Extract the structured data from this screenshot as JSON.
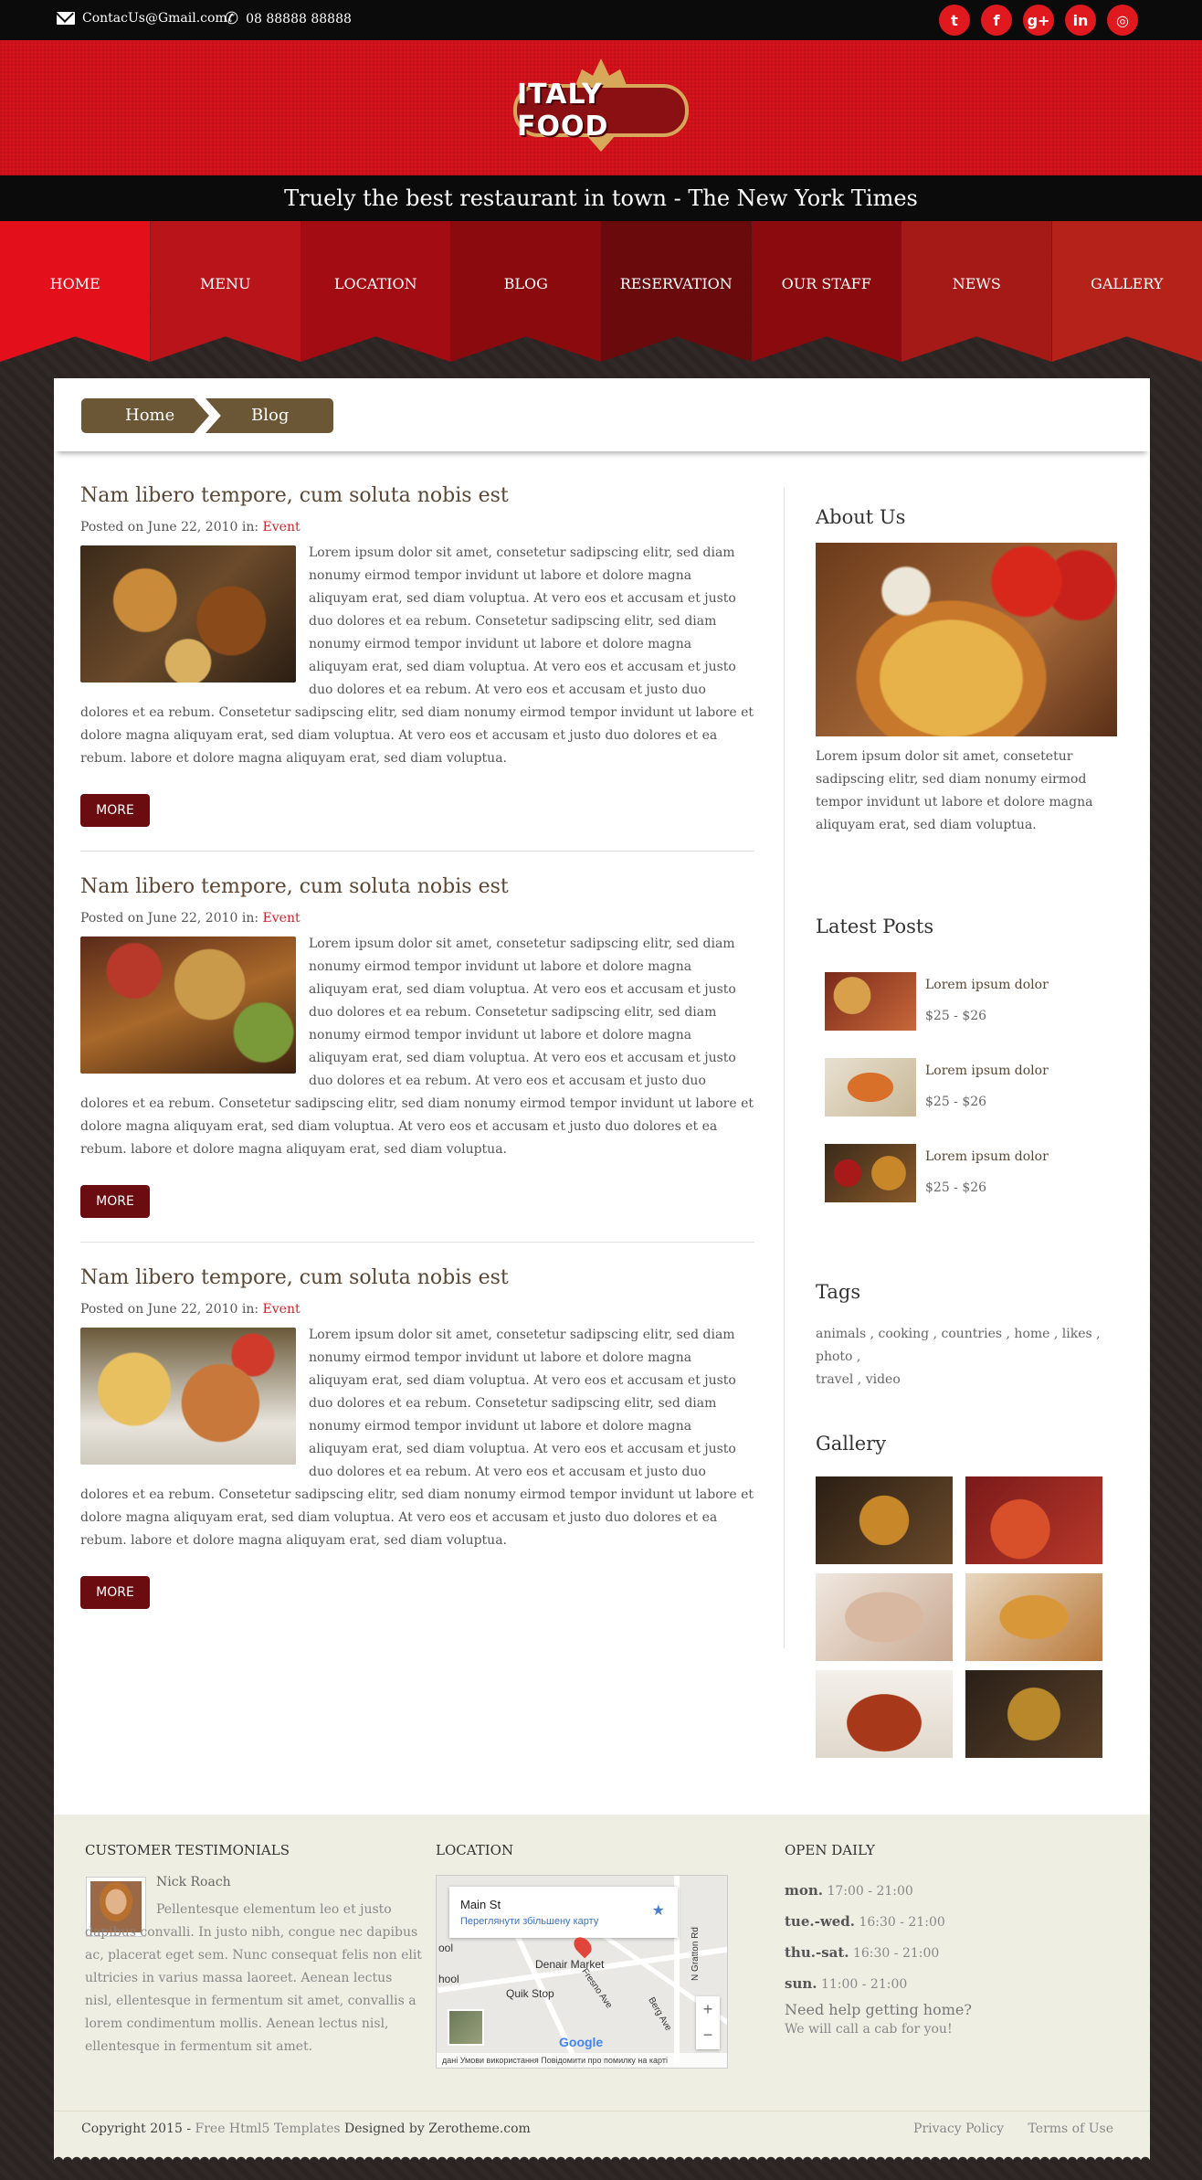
{
  "topbar": {
    "email": "ContacUs@Gmail.com",
    "phone": "08 88888 88888",
    "socials": [
      {
        "icon": "twitter-icon",
        "glyph": "t"
      },
      {
        "icon": "facebook-icon",
        "glyph": "f"
      },
      {
        "icon": "google-plus-icon",
        "glyph": "g+"
      },
      {
        "icon": "linkedin-icon",
        "glyph": "in"
      },
      {
        "icon": "instagram-icon",
        "glyph": "◎"
      }
    ]
  },
  "header": {
    "logo_text": "ITALY FOOD",
    "tagline": "Truely the best restaurant in town - The New York Times"
  },
  "nav": {
    "items": [
      {
        "label": "HOME",
        "color": "#e3101b"
      },
      {
        "label": "MENU",
        "color": "#b9141a"
      },
      {
        "label": "LOCATION",
        "color": "#a30c12"
      },
      {
        "label": "BLOG",
        "color": "#8a0a0e"
      },
      {
        "label": "RESERVATION",
        "color": "#6a0a0c"
      },
      {
        "label": "OUR STAFF",
        "color": "#8a0a0e"
      },
      {
        "label": "NEWS",
        "color": "#a51a17"
      },
      {
        "label": "GALLERY",
        "color": "#b5221a"
      }
    ]
  },
  "breadcrumb": {
    "home": "Home",
    "current": "Blog"
  },
  "posts": [
    {
      "title": "Nam libero tempore, cum soluta nobis est",
      "meta_prefix": "Posted on June 22, 2010 in:",
      "category": "Event",
      "body": "Lorem ipsum dolor sit amet, consetetur sadipscing elitr, sed diam nonumy eirmod tempor invidunt ut labore et dolore magna aliquyam erat, sed diam voluptua. At vero eos et accusam et justo duo dolores et ea rebum. Consetetur sadipscing elitr, sed diam nonumy eirmod tempor invidunt ut labore et dolore magna aliquyam erat, sed diam voluptua. At vero eos et accusam et justo duo dolores et ea rebum. At vero eos et accusam et justo duo dolores et ea rebum. Consetetur sadipscing elitr, sed diam nonumy eirmod tempor invidunt ut labore et dolore magna aliquyam erat, sed diam voluptua. At vero eos et accusam et justo duo dolores et ea rebum. labore et dolore magna aliquyam erat, sed diam voluptua.",
      "more": "MORE"
    },
    {
      "title": "Nam libero tempore, cum soluta nobis est",
      "meta_prefix": "Posted on June 22, 2010 in:",
      "category": "Event",
      "body": "Lorem ipsum dolor sit amet, consetetur sadipscing elitr, sed diam nonumy eirmod tempor invidunt ut labore et dolore magna aliquyam erat, sed diam voluptua. At vero eos et accusam et justo duo dolores et ea rebum. Consetetur sadipscing elitr, sed diam nonumy eirmod tempor invidunt ut labore et dolore magna aliquyam erat, sed diam voluptua. At vero eos et accusam et justo duo dolores et ea rebum. At vero eos et accusam et justo duo dolores et ea rebum. Consetetur sadipscing elitr, sed diam nonumy eirmod tempor invidunt ut labore et dolore magna aliquyam erat, sed diam voluptua. At vero eos et accusam et justo duo dolores et ea rebum. labore et dolore magna aliquyam erat, sed diam voluptua.",
      "more": "MORE"
    },
    {
      "title": "Nam libero tempore, cum soluta nobis est",
      "meta_prefix": "Posted on June 22, 2010 in:",
      "category": "Event",
      "body": "Lorem ipsum dolor sit amet, consetetur sadipscing elitr, sed diam nonumy eirmod tempor invidunt ut labore et dolore magna aliquyam erat, sed diam voluptua. At vero eos et accusam et justo duo dolores et ea rebum. Consetetur sadipscing elitr, sed diam nonumy eirmod tempor invidunt ut labore et dolore magna aliquyam erat, sed diam voluptua. At vero eos et accusam et justo duo dolores et ea rebum. At vero eos et accusam et justo duo dolores et ea rebum. Consetetur sadipscing elitr, sed diam nonumy eirmod tempor invidunt ut labore et dolore magna aliquyam erat, sed diam voluptua. At vero eos et accusam et justo duo dolores et ea rebum. labore et dolore magna aliquyam erat, sed diam voluptua.",
      "more": "MORE"
    }
  ],
  "sidebar": {
    "about_title": "About Us",
    "about_text": "Lorem ipsum dolor sit amet, consetetur sadipscing elitr, sed diam nonumy eirmod tempor invidunt ut labore et dolore magna aliquyam erat, sed diam voluptua.",
    "latest_title": "Latest Posts",
    "latest": [
      {
        "title": "Lorem ipsum dolor",
        "price": "$25 - $26"
      },
      {
        "title": "Lorem ipsum dolor",
        "price": "$25 - $26"
      },
      {
        "title": "Lorem ipsum dolor",
        "price": "$25 - $26"
      }
    ],
    "tags_title": "Tags",
    "tags": [
      "animals",
      "cooking",
      "countries",
      "home",
      "likes",
      "photo",
      "travel",
      "video"
    ],
    "gallery_title": "Gallery"
  },
  "footer": {
    "testimonials_title": "CUSTOMER TESTIMONIALS",
    "testimonial_name": "Nick Roach",
    "testimonial_text": "Pellentesque elementum leo et justo dapibus convalli. In justo nibh, congue nec dapibus ac, placerat eget sem. Nunc consequat felis non elit ultricies in varius massa laoreet. Aenean lectus nisl, ellentesque in fermentum sit amet, convallis a lorem condimentum mollis. Aenean lectus nisl, ellentesque in fermentum sit amet.",
    "location_title": "LOCATION",
    "map": {
      "place": "Main St",
      "view_larger": "Переглянути збільшену карту",
      "label_market": "Denair Market",
      "label_quik": "Quik Stop",
      "label_ool1": "ool",
      "label_ool2": "hool",
      "street1": "N Gratton Rd",
      "street2": "Fresno Ave",
      "street3": "Berg Ave",
      "google": "Google",
      "footer_text": "дані  Умови використання  Повідомити про помилку на карті"
    },
    "open_title": "OPEN DAILY",
    "hours": [
      {
        "day": "mon.",
        "time": "17:00 - 21:00"
      },
      {
        "day": "tue.-wed.",
        "time": "16:30 - 21:00"
      },
      {
        "day": "thu.-sat.",
        "time": "16:30 - 21:00"
      },
      {
        "day": "sun.",
        "time": "11:00 - 21:00"
      }
    ],
    "need_help": "Need help getting home?",
    "cab": "We will call a cab for you!",
    "copyright_prefix": "Copyright 2015 -",
    "free_templates": "Free Html5 Templates",
    "designed_by": "Designed by Zerotheme.com",
    "privacy": "Privacy Policy",
    "terms": "Terms of Use"
  }
}
